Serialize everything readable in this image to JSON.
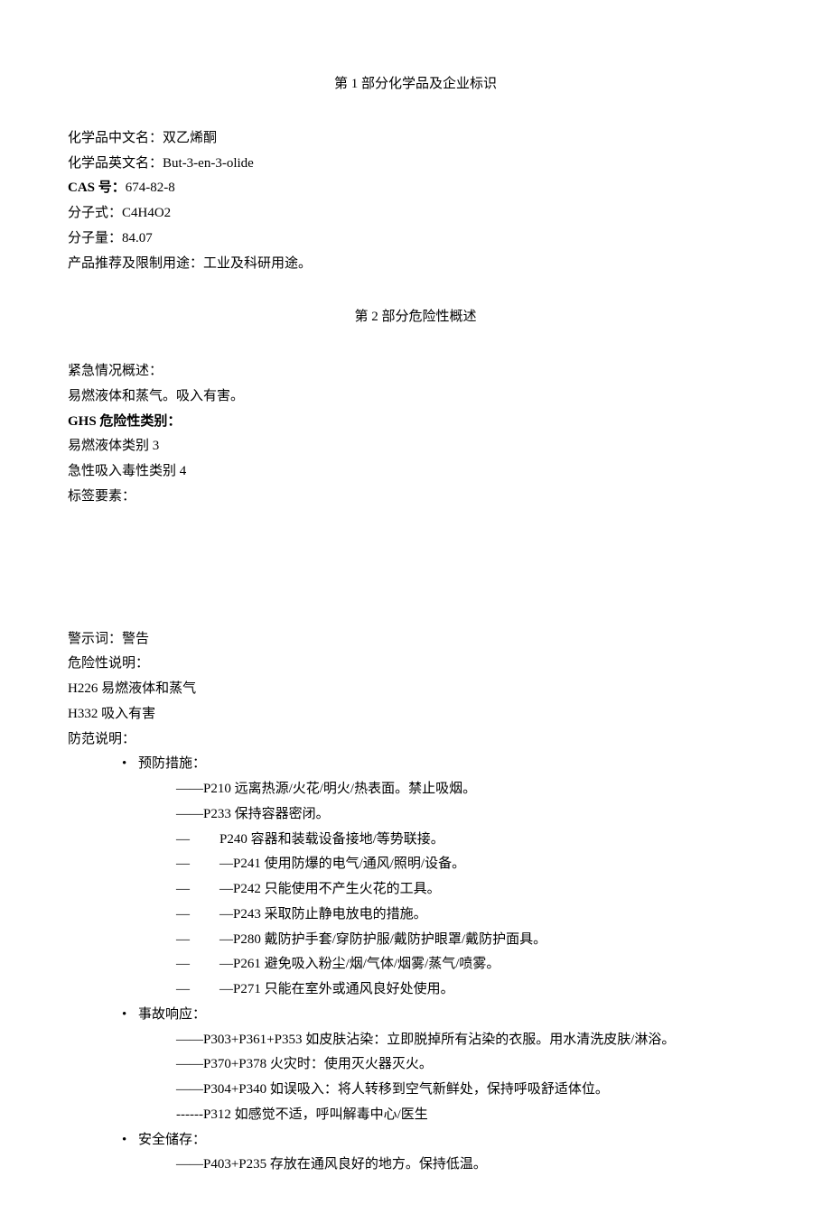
{
  "section1": {
    "title": "第 1 部分化学品及企业标识",
    "fields": {
      "cn_name_label": "化学品中文名：",
      "cn_name_value": "双乙烯酮",
      "en_name_label": "化学品英文名：",
      "en_name_value": "But-3-en-3-olide",
      "cas_label": "CAS 号：",
      "cas_value": "674-82-8",
      "formula_label": "分子式：",
      "formula_value": "C4H4O2",
      "weight_label": "分子量：",
      "weight_value": "84.07",
      "usage_label": "产品推荐及限制用途：",
      "usage_value": "工业及科研用途。"
    }
  },
  "section2": {
    "title": "第 2 部分危险性概述",
    "emergency": {
      "label": "紧急情况概述：",
      "text": "易燃液体和蒸气。吸入有害。"
    },
    "ghs": {
      "label": "GHS 危险性类别：",
      "cat1": "易燃液体类别 3",
      "cat2": "急性吸入毒性类别 4"
    },
    "label_elements": "标签要素：",
    "signal": {
      "label": "警示词：",
      "value": "警告"
    },
    "hazard": {
      "label": "危险性说明：",
      "h226": "H226 易燃液体和蒸气",
      "h332": "H332 吸入有害"
    },
    "precaution": {
      "label": "防范说明：",
      "prevention": {
        "title": "预防措施：",
        "p210": "——P210 远离热源/火花/明火/热表面。禁止吸烟。",
        "p233": "——P233 保持容器密闭。",
        "p240_dash": "—",
        "p240": "P240 容器和装载设备接地/等势联接。",
        "p241_dash": "—",
        "p241": "—P241 使用防爆的电气/通风/照明/设备。",
        "p242_dash": "—",
        "p242": "—P242 只能使用不产生火花的工具。",
        "p243_dash": "—",
        "p243": "—P243 采取防止静电放电的措施。",
        "p280_dash": "—",
        "p280": "—P280 戴防护手套/穿防护服/戴防护眼罩/戴防护面具。",
        "p261_dash": "—",
        "p261": "—P261 避免吸入粉尘/烟/气体/烟雾/蒸气/喷雾。",
        "p271_dash": "—",
        "p271": "—P271 只能在室外或通风良好处使用。"
      },
      "response": {
        "title": "事故响应：",
        "p303": "——P303+P361+P353 如皮肤沾染：立即脱掉所有沾染的衣服。用水清洗皮肤/淋浴。",
        "p370": "——P370+P378 火灾时：使用灭火器灭火。",
        "p304": "——P304+P340 如误吸入：将人转移到空气新鲜处，保持呼吸舒适体位。",
        "p312": "------P312 如感觉不适，呼叫解毒中心/医生"
      },
      "storage": {
        "title": "安全储存：",
        "p403": "——P403+P235 存放在通风良好的地方。保持低温。"
      }
    }
  }
}
